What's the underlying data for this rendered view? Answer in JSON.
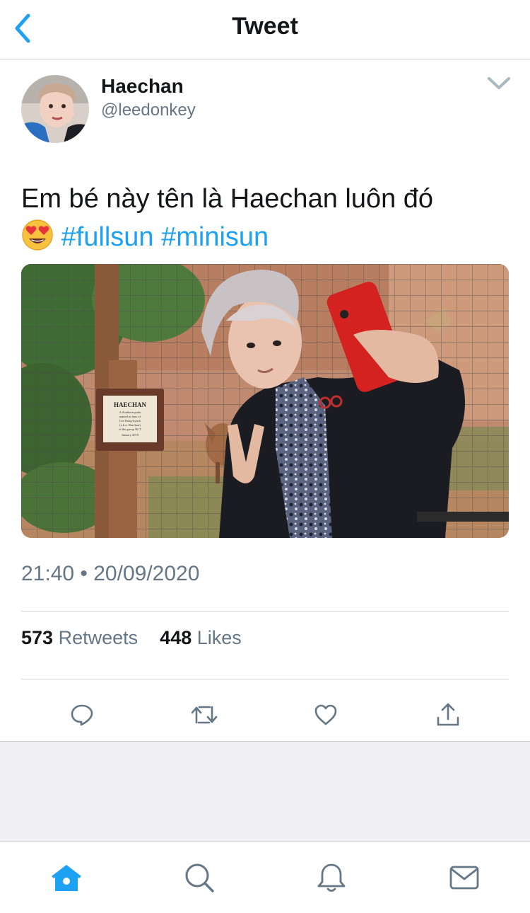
{
  "header": {
    "title": "Tweet",
    "back_icon": "back-chevron-icon"
  },
  "author": {
    "name": "Haechan",
    "handle": "@leedonkey"
  },
  "tweet": {
    "text_plain": "Em bé này tên là Haechan luôn đó",
    "emoji": "😍",
    "hashtags": [
      "#fullsun",
      "#minisun"
    ],
    "timestamp": "21:40 • 20/09/2020"
  },
  "media": {
    "sign": {
      "title": "HAECHAN",
      "lines": [
        "A Southern pudu",
        "named in fans of",
        "Lee Dong-hyuck",
        "(a.k.a. Haechan)",
        "of the group NCT",
        "January 2019"
      ]
    }
  },
  "stats": {
    "retweets_count": "573",
    "retweets_label": "Retweets",
    "likes_count": "448",
    "likes_label": "Likes"
  },
  "actions": [
    "reply-icon",
    "retweet-icon",
    "like-icon",
    "share-icon"
  ],
  "tabs": [
    "home-icon",
    "search-icon",
    "notifications-icon",
    "messages-icon"
  ],
  "colors": {
    "accent": "#1da1f2",
    "text": "#14171a",
    "secondary": "#657786",
    "icon_gray": "#657786"
  }
}
